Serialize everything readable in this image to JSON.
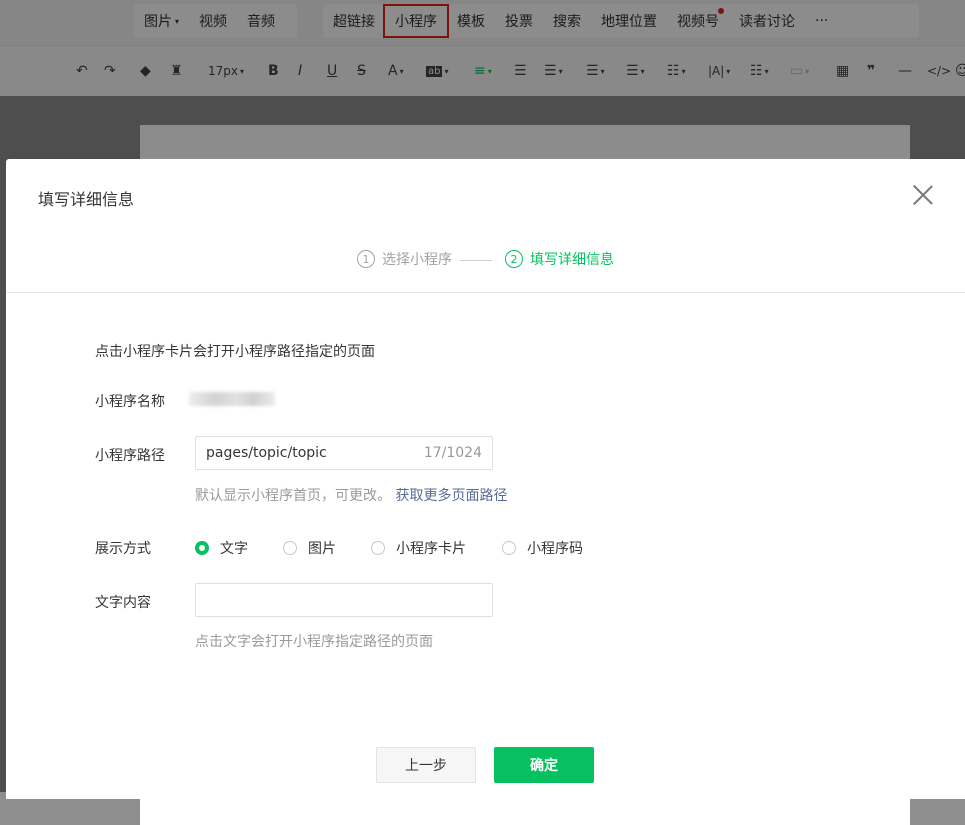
{
  "editor": {
    "menu_group1": [
      "图片",
      "视频",
      "音频"
    ],
    "menu_group2": [
      "超链接",
      "小程序",
      "模板",
      "投票",
      "搜索",
      "地理位置",
      "视频号",
      "读者讨论",
      "···"
    ],
    "font_size": "17px"
  },
  "dialog": {
    "title": "填写详细信息",
    "steps": [
      {
        "num": "1",
        "label": "选择小程序"
      },
      {
        "num": "2",
        "label": "填写详细信息"
      }
    ],
    "intro": "点击小程序卡片会打开小程序路径指定的页面",
    "name_label": "小程序名称",
    "path_label": "小程序路径",
    "path_value": "pages/topic/topic",
    "path_count": "17/1024",
    "path_hint": "默认显示小程序首页，可更改。",
    "path_link": "获取更多页面路径",
    "mode_label": "展示方式",
    "modes": [
      "文字",
      "图片",
      "小程序卡片",
      "小程序码"
    ],
    "text_label": "文字内容",
    "text_hint": "点击文字会打开小程序指定路径的页面",
    "prev_button": "上一步",
    "ok_button": "确定"
  },
  "colors": {
    "accent": "#07c160",
    "link": "#576b95",
    "highlight": "#e0251c"
  }
}
